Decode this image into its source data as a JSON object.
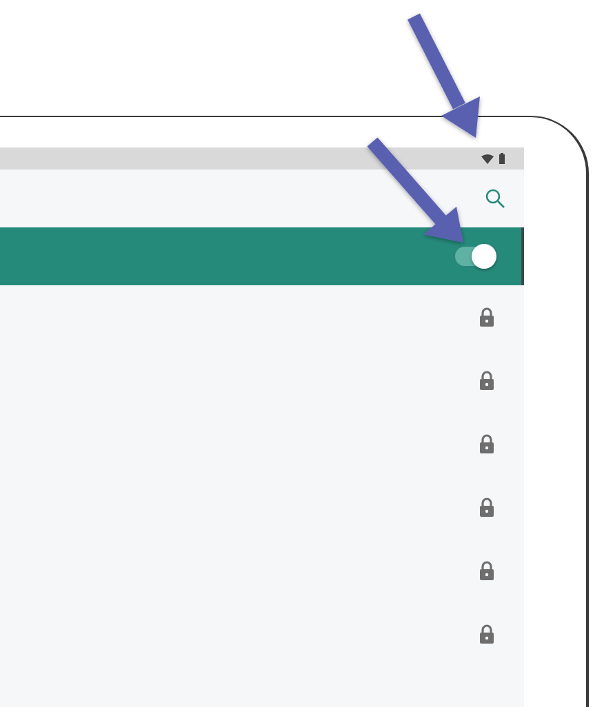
{
  "master_switch": {
    "on": true
  },
  "networks": [
    {
      "locked": true
    },
    {
      "locked": true
    },
    {
      "locked": true
    },
    {
      "locked": true
    },
    {
      "locked": true
    },
    {
      "locked": true
    }
  ]
}
